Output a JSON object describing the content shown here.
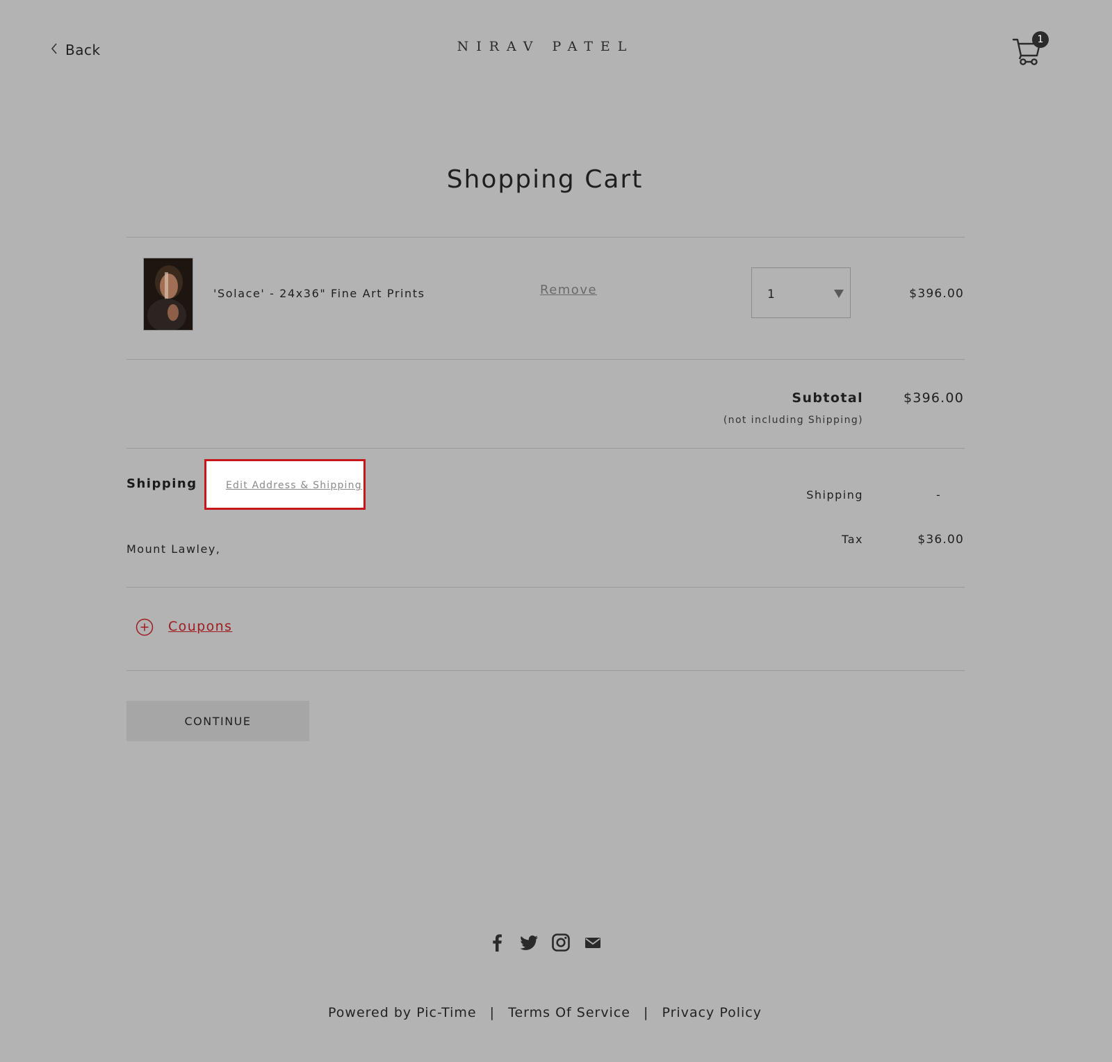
{
  "header": {
    "back_label": "Back",
    "brand": "NIRAV PATEL",
    "cart_count": "1",
    "back_icon": "chevron-left-icon",
    "cart_icon": "shopping-cart-icon"
  },
  "page": {
    "title": "Shopping Cart"
  },
  "cart": {
    "items": [
      {
        "name": "'Solace' - 24x36\" Fine Art Prints",
        "remove_label": "Remove",
        "quantity": "1",
        "price": "$396.00"
      }
    ]
  },
  "summary": {
    "subtotal_label": "Subtotal",
    "subtotal_note": "(not including Shipping)",
    "subtotal_value": "$396.00",
    "shipping_label": "Shipping",
    "shipping_value": "-",
    "tax_label": "Tax",
    "tax_value": "$36.00"
  },
  "shipping": {
    "heading": "Shipping",
    "edit_label": "Edit Address & Shipping",
    "address": "Mount Lawley,"
  },
  "coupons": {
    "label": "Coupons",
    "icon": "plus-circle-icon"
  },
  "actions": {
    "continue_label": "CONTINUE"
  },
  "footer": {
    "social_icons": [
      "facebook-icon",
      "twitter-icon",
      "instagram-icon",
      "email-icon"
    ],
    "powered_by": "Powered by Pic-Time",
    "terms": "Terms Of Service",
    "privacy": "Privacy Policy",
    "separator": "|"
  },
  "colors": {
    "page_background": "#b3b3b3",
    "highlight_border": "#c8161d",
    "coupon_red": "#9e1b20",
    "button_background": "#a6a6a6"
  }
}
